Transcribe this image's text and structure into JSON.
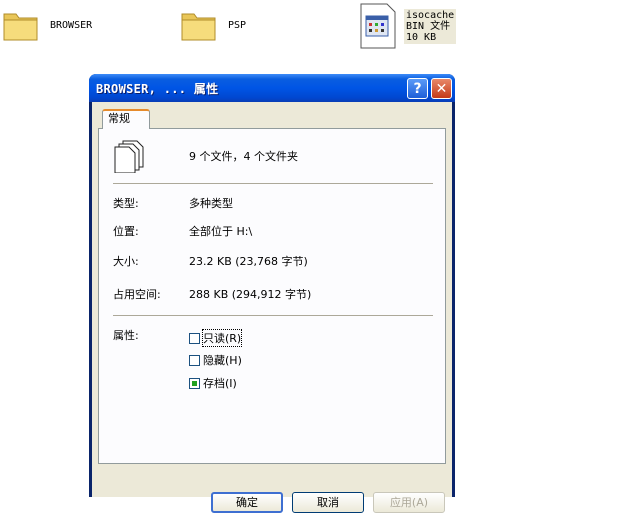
{
  "desktop": {
    "items": [
      {
        "label": "BROWSER",
        "icon": "folder-icon"
      },
      {
        "label": "PSP",
        "icon": "folder-icon"
      }
    ],
    "file": {
      "name": "isocache",
      "type": "BIN 文件",
      "size": "10 KB",
      "icon": "bin-file-icon"
    }
  },
  "dialog": {
    "title": "BROWSER, ... 属性",
    "help_label": "?",
    "close_label": "✕",
    "tab": "常规",
    "summary": "9 个文件，4 个文件夹",
    "rows": [
      {
        "label": "类型:",
        "value": "多种类型"
      },
      {
        "label": "位置:",
        "value": "全部位于 H:\\"
      },
      {
        "label": "大小:",
        "value": "23.2 KB (23,768 字节)"
      },
      {
        "label": "占用空间:",
        "value": "288 KB (294,912 字节)"
      }
    ],
    "attributes_label": "属性:",
    "attributes": [
      {
        "label": "只读(R)",
        "checked": false
      },
      {
        "label": "隐藏(H)",
        "checked": false
      },
      {
        "label": "存档(I)",
        "checked": true
      }
    ],
    "buttons": {
      "ok": "确定",
      "cancel": "取消",
      "apply": "应用(A)"
    }
  },
  "colors": {
    "titlebar": "#0055e5",
    "dialog_bg": "#ece9d8",
    "tab_accent": "#e68b2c",
    "archive_check": "#21a121"
  }
}
